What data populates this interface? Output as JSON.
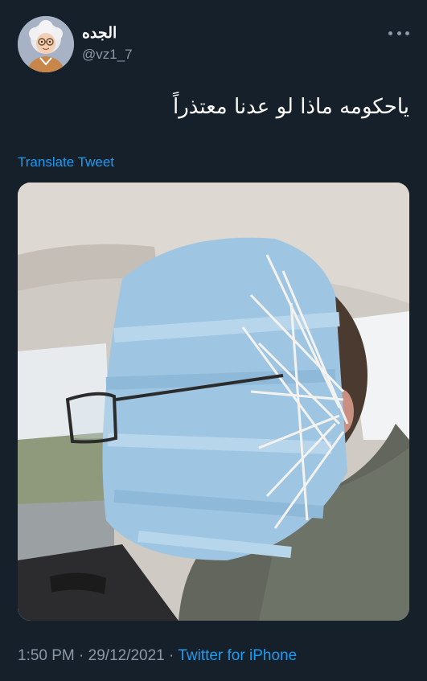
{
  "tweet": {
    "display_name": "الجده",
    "handle": "@vz1_7",
    "text": "ياحكومه ماذا لو عدنا معتذراً",
    "translate_label": "Translate Tweet",
    "time": "1:50 PM",
    "separator": "·",
    "date": "29/12/2021",
    "source": "Twitter for iPhone",
    "more_icon": "more-horizontal-icon"
  },
  "colors": {
    "background": "#15202b",
    "secondary_text": "#8b98a5",
    "link": "#1d9bf0"
  }
}
